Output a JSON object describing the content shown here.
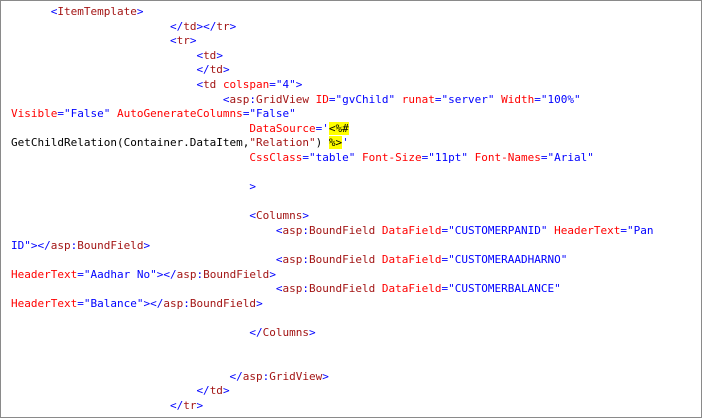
{
  "colors": {
    "markup": "#0000ff",
    "element": "#a31515",
    "attribute": "#ff0000",
    "text": "#000000",
    "highlight": "#ffff00"
  },
  "code_lines": [
    [
      {
        "t": "      ",
        "c": "t"
      },
      {
        "t": "<",
        "c": "b"
      },
      {
        "t": "ItemTemplate",
        "c": "r"
      },
      {
        "t": ">",
        "c": "b"
      }
    ],
    [
      {
        "t": "                        ",
        "c": "t"
      },
      {
        "t": "</",
        "c": "b"
      },
      {
        "t": "td",
        "c": "r"
      },
      {
        "t": "></",
        "c": "b"
      },
      {
        "t": "tr",
        "c": "r"
      },
      {
        "t": ">",
        "c": "b"
      }
    ],
    [
      {
        "t": "                        ",
        "c": "t"
      },
      {
        "t": "<",
        "c": "b"
      },
      {
        "t": "tr",
        "c": "r"
      },
      {
        "t": ">",
        "c": "b"
      }
    ],
    [
      {
        "t": "                            ",
        "c": "t"
      },
      {
        "t": "<",
        "c": "b"
      },
      {
        "t": "td",
        "c": "r"
      },
      {
        "t": ">",
        "c": "b"
      }
    ],
    [
      {
        "t": "                            ",
        "c": "t"
      },
      {
        "t": "</",
        "c": "b"
      },
      {
        "t": "td",
        "c": "r"
      },
      {
        "t": ">",
        "c": "b"
      }
    ],
    [
      {
        "t": "                            ",
        "c": "t"
      },
      {
        "t": "<",
        "c": "b"
      },
      {
        "t": "td",
        "c": "r"
      },
      {
        "t": " ",
        "c": "t"
      },
      {
        "t": "colspan",
        "c": "k"
      },
      {
        "t": "=\"4\">",
        "c": "b"
      }
    ],
    [
      {
        "t": "                                ",
        "c": "t"
      },
      {
        "t": "<",
        "c": "b"
      },
      {
        "t": "asp",
        "c": "r"
      },
      {
        "t": ":",
        "c": "b"
      },
      {
        "t": "GridView",
        "c": "r"
      },
      {
        "t": " ",
        "c": "t"
      },
      {
        "t": "ID",
        "c": "k"
      },
      {
        "t": "=\"gvChild\"",
        "c": "b"
      },
      {
        "t": " ",
        "c": "t"
      },
      {
        "t": "runat",
        "c": "k"
      },
      {
        "t": "=\"server\"",
        "c": "b"
      },
      {
        "t": " ",
        "c": "t"
      },
      {
        "t": "Width",
        "c": "k"
      },
      {
        "t": "=\"100%\"",
        "c": "b"
      }
    ],
    [
      {
        "t": "Visible",
        "c": "k"
      },
      {
        "t": "=\"False\"",
        "c": "b"
      },
      {
        "t": " ",
        "c": "t"
      },
      {
        "t": "AutoGenerateColumns",
        "c": "k"
      },
      {
        "t": "=\"False\"",
        "c": "b"
      }
    ],
    [
      {
        "t": "                                    ",
        "c": "t"
      },
      {
        "t": "DataSource",
        "c": "k"
      },
      {
        "t": "='",
        "c": "b"
      },
      {
        "t": "<%#",
        "c": "hl"
      }
    ],
    [
      {
        "t": "GetChildRelation(Container.DataItem,",
        "c": "t"
      },
      {
        "t": "\"Relation\"",
        "c": "r"
      },
      {
        "t": ") ",
        "c": "t"
      },
      {
        "t": "%>",
        "c": "hl"
      },
      {
        "t": "'",
        "c": "b"
      }
    ],
    [
      {
        "t": "                                    ",
        "c": "t"
      },
      {
        "t": "CssClass",
        "c": "k"
      },
      {
        "t": "=\"table\"",
        "c": "b"
      },
      {
        "t": " ",
        "c": "t"
      },
      {
        "t": "Font-Size",
        "c": "k"
      },
      {
        "t": "=\"11pt\"",
        "c": "b"
      },
      {
        "t": " ",
        "c": "t"
      },
      {
        "t": "Font-Names",
        "c": "k"
      },
      {
        "t": "=\"Arial\"",
        "c": "b"
      }
    ],
    [],
    [
      {
        "t": "                                    ",
        "c": "t"
      },
      {
        "t": ">",
        "c": "b"
      }
    ],
    [],
    [
      {
        "t": "                                    ",
        "c": "t"
      },
      {
        "t": "<",
        "c": "b"
      },
      {
        "t": "Columns",
        "c": "r"
      },
      {
        "t": ">",
        "c": "b"
      }
    ],
    [
      {
        "t": "                                        ",
        "c": "t"
      },
      {
        "t": "<",
        "c": "b"
      },
      {
        "t": "asp",
        "c": "r"
      },
      {
        "t": ":",
        "c": "b"
      },
      {
        "t": "BoundField",
        "c": "r"
      },
      {
        "t": " ",
        "c": "t"
      },
      {
        "t": "DataField",
        "c": "k"
      },
      {
        "t": "=\"CUSTOMERPANID\"",
        "c": "b"
      },
      {
        "t": " ",
        "c": "t"
      },
      {
        "t": "HeaderText",
        "c": "k"
      },
      {
        "t": "=\"Pan",
        "c": "b"
      }
    ],
    [
      {
        "t": "ID\"></",
        "c": "b"
      },
      {
        "t": "asp",
        "c": "r"
      },
      {
        "t": ":",
        "c": "b"
      },
      {
        "t": "BoundField",
        "c": "r"
      },
      {
        "t": ">",
        "c": "b"
      }
    ],
    [
      {
        "t": "                                        ",
        "c": "t"
      },
      {
        "t": "<",
        "c": "b"
      },
      {
        "t": "asp",
        "c": "r"
      },
      {
        "t": ":",
        "c": "b"
      },
      {
        "t": "BoundField",
        "c": "r"
      },
      {
        "t": " ",
        "c": "t"
      },
      {
        "t": "DataField",
        "c": "k"
      },
      {
        "t": "=\"CUSTOMERAADHARNO\"",
        "c": "b"
      }
    ],
    [
      {
        "t": "HeaderText",
        "c": "k"
      },
      {
        "t": "=\"Aadhar No\"></",
        "c": "b"
      },
      {
        "t": "asp",
        "c": "r"
      },
      {
        "t": ":",
        "c": "b"
      },
      {
        "t": "BoundField",
        "c": "r"
      },
      {
        "t": ">",
        "c": "b"
      }
    ],
    [
      {
        "t": "                                        ",
        "c": "t"
      },
      {
        "t": "<",
        "c": "b"
      },
      {
        "t": "asp",
        "c": "r"
      },
      {
        "t": ":",
        "c": "b"
      },
      {
        "t": "BoundField",
        "c": "r"
      },
      {
        "t": " ",
        "c": "t"
      },
      {
        "t": "DataField",
        "c": "k"
      },
      {
        "t": "=\"CUSTOMERBALANCE\"",
        "c": "b"
      }
    ],
    [
      {
        "t": "HeaderText",
        "c": "k"
      },
      {
        "t": "=\"Balance\"></",
        "c": "b"
      },
      {
        "t": "asp",
        "c": "r"
      },
      {
        "t": ":",
        "c": "b"
      },
      {
        "t": "BoundField",
        "c": "r"
      },
      {
        "t": ">",
        "c": "b"
      }
    ],
    [],
    [
      {
        "t": "                                    ",
        "c": "t"
      },
      {
        "t": "</",
        "c": "b"
      },
      {
        "t": "Columns",
        "c": "r"
      },
      {
        "t": ">",
        "c": "b"
      }
    ],
    [],
    [],
    [
      {
        "t": "                                 ",
        "c": "t"
      },
      {
        "t": "</",
        "c": "b"
      },
      {
        "t": "asp",
        "c": "r"
      },
      {
        "t": ":",
        "c": "b"
      },
      {
        "t": "GridView",
        "c": "r"
      },
      {
        "t": ">",
        "c": "b"
      }
    ],
    [
      {
        "t": "                            ",
        "c": "t"
      },
      {
        "t": "</",
        "c": "b"
      },
      {
        "t": "td",
        "c": "r"
      },
      {
        "t": ">",
        "c": "b"
      }
    ],
    [
      {
        "t": "                        ",
        "c": "t"
      },
      {
        "t": "</",
        "c": "b"
      },
      {
        "t": "tr",
        "c": "r"
      },
      {
        "t": ">",
        "c": "b"
      }
    ]
  ]
}
